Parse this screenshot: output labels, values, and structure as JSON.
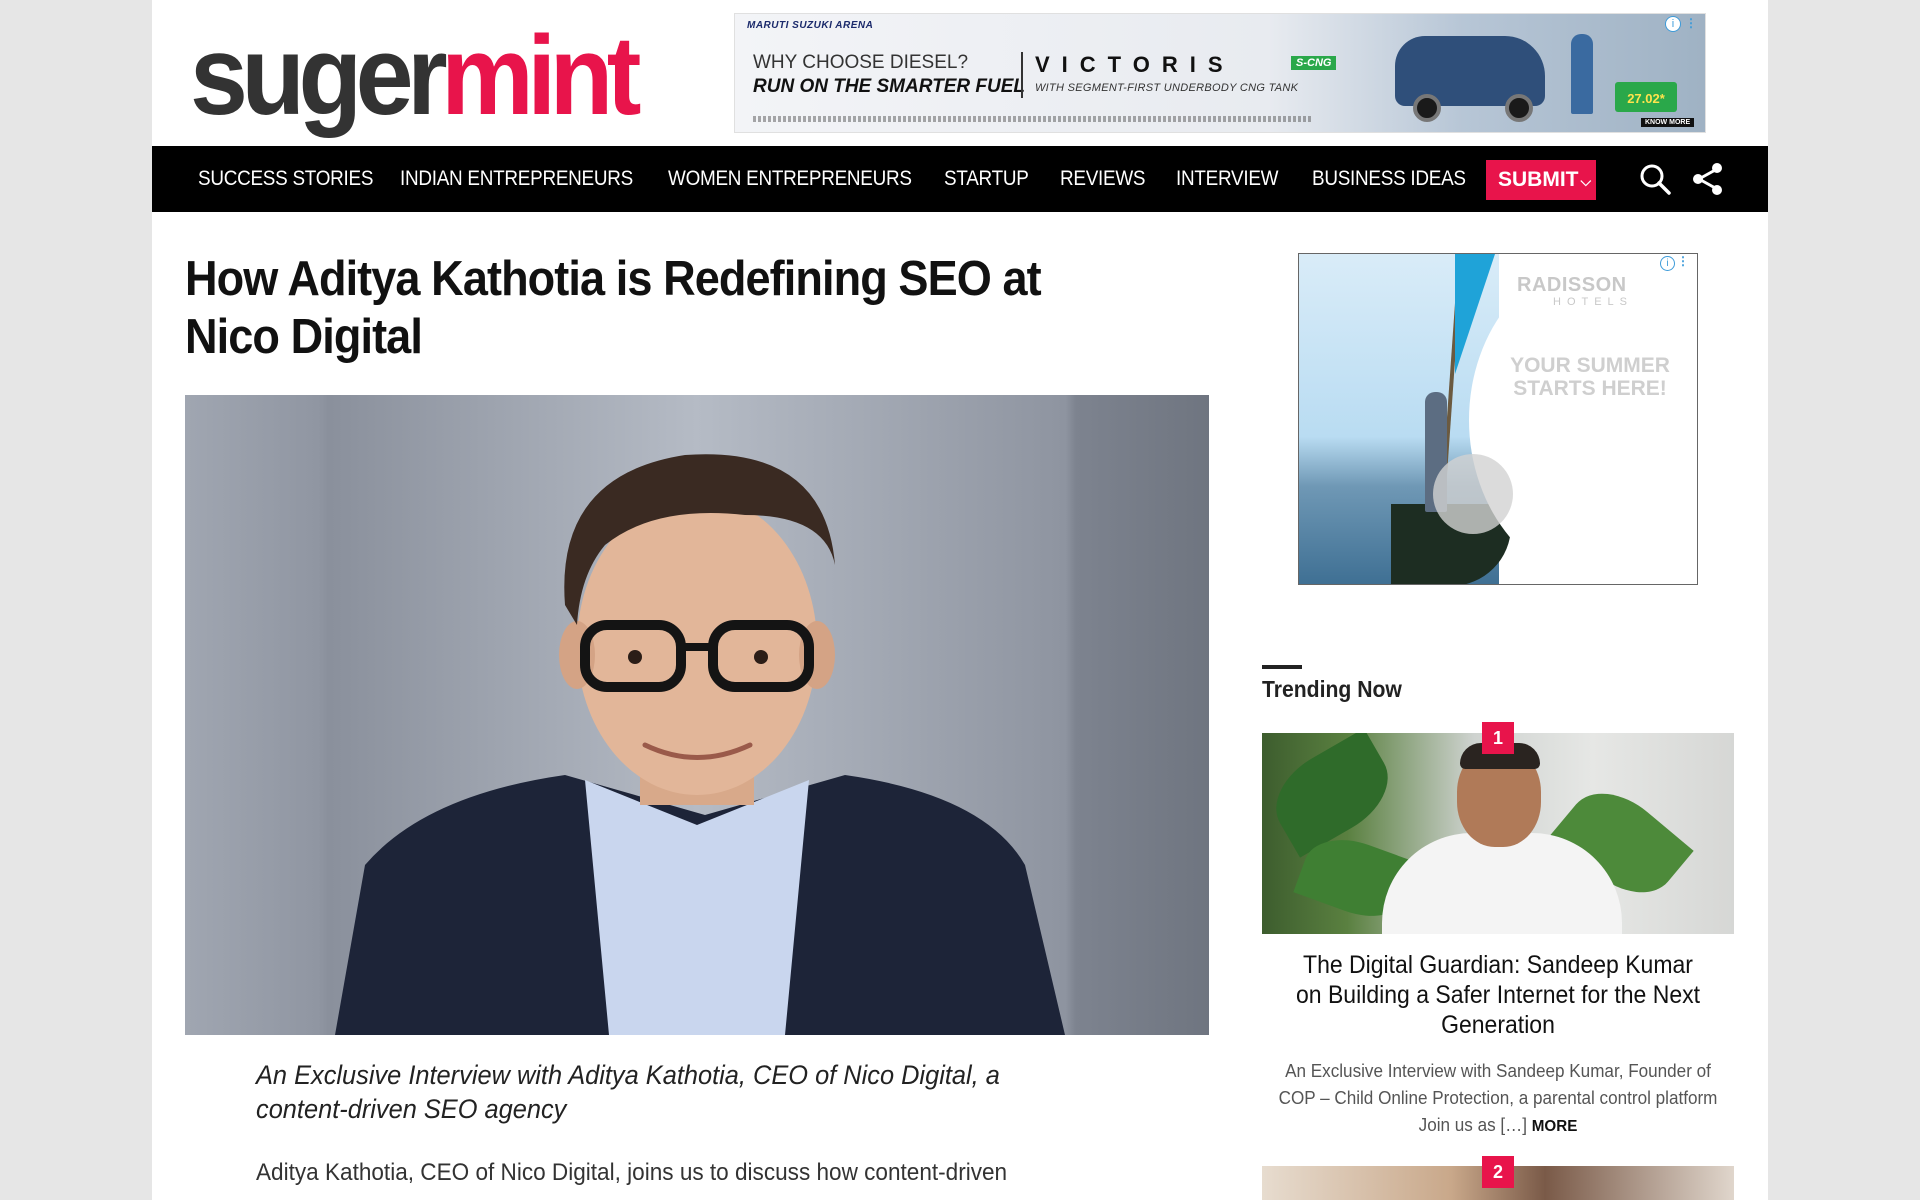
{
  "site": {
    "logo_part1": "suger",
    "logo_part2": "mint",
    "brand_color": "#e8144b"
  },
  "top_ad": {
    "brand": "MARUTI SUZUKI ARENA",
    "question": "WHY CHOOSE DIESEL?",
    "headline": "RUN ON THE SMARTER FUEL",
    "model": "VICTORIS",
    "badge_cng": "S-CNG",
    "tagline": "WITH SEGMENT-FIRST UNDERBODY CNG TANK",
    "mileage": "27.02*",
    "cta": "KNOW MORE",
    "info_icon": "info-icon",
    "menu_icon": "more-vertical-icon"
  },
  "nav": {
    "items": [
      {
        "label": "SUCCESS STORIES"
      },
      {
        "label": "INDIAN ENTREPRENEURS"
      },
      {
        "label": "WOMEN ENTREPRENEURS"
      },
      {
        "label": "STARTUP"
      },
      {
        "label": "REVIEWS"
      },
      {
        "label": "INTERVIEW"
      },
      {
        "label": "BUSINESS IDEAS"
      }
    ],
    "submit_label": "SUBMIT",
    "search_icon": "search-icon",
    "share_icon": "share-icon"
  },
  "article": {
    "title": "How Aditya Kathotia is Redefining SEO at Nico Digital",
    "subtitle": "An Exclusive Interview with Aditya Kathotia, CEO of Nico Digital, a content-driven SEO agency",
    "body_start": "Aditya Kathotia, CEO of Nico Digital, joins us to discuss how content-driven"
  },
  "side_ad": {
    "brand": "RADISSON",
    "brand_sub": "HOTELS",
    "headline": "YOUR SUMMER STARTS HERE!"
  },
  "trending": {
    "title": "Trending Now",
    "items": [
      {
        "rank": "1",
        "headline": "The Digital Guardian: Sandeep Kumar on Building a Safer Internet for the Next Generation",
        "excerpt": "An Exclusive Interview with Sandeep Kumar, Founder of COP – Child Online Protection, a parental control platform Join us as […]",
        "more": "MORE"
      },
      {
        "rank": "2"
      }
    ]
  }
}
